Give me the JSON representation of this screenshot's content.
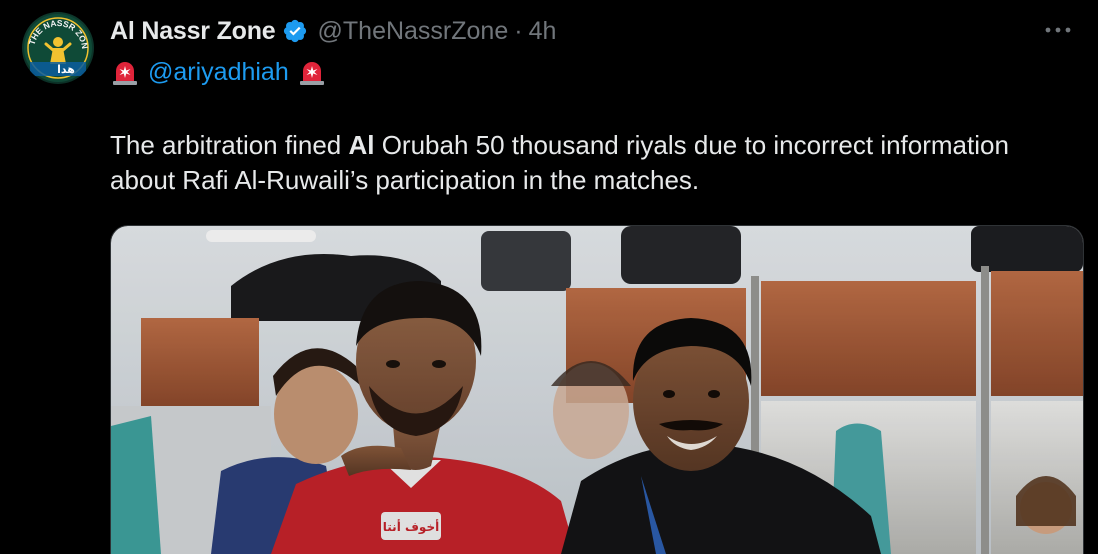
{
  "author": {
    "display_name": "Al Nassr Zone",
    "handle": "@TheNassrZone",
    "separator": "·",
    "timestamp": "4h",
    "verified": true,
    "avatar_text": "THE NASSR ZONE",
    "avatar_text_ar": "هدا"
  },
  "mention_line": {
    "leading_icon": "police-siren-icon",
    "mention": "@ariyadhiah",
    "trailing_icon": "police-siren-icon"
  },
  "tweet_text": {
    "part1": "The arbitration fined ",
    "bold": "Al",
    "part2": " Orubah 50 thousand riyals due to incorrect information about Rafi Al-Ruwaili’s participation in the matches."
  },
  "media": {
    "type": "photo",
    "description_icon": "photo-locker-room",
    "jersey_text_ar": "أخوف أنتا"
  },
  "icons": {
    "more": "more-horizontal-icon",
    "verified": "verified-badge-icon"
  },
  "colors": {
    "background": "#000000",
    "text_primary": "#e7e9ea",
    "text_secondary": "#71767b",
    "link": "#1d9bf0",
    "verified": "#1d9bf0"
  }
}
